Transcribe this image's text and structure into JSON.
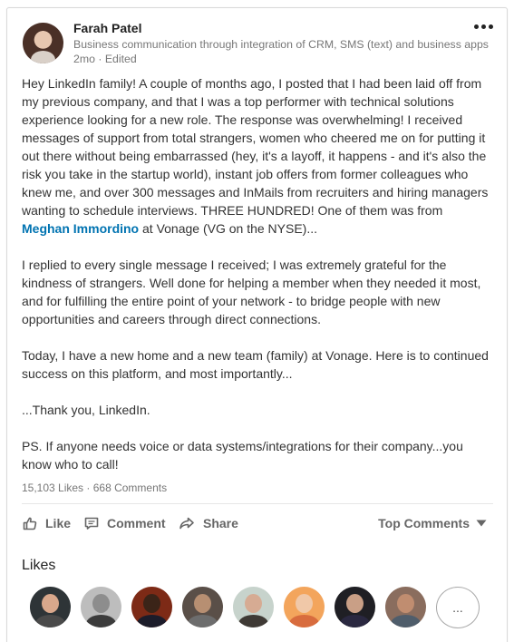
{
  "post": {
    "author_name": "Farah Patel",
    "author_headline": "Business communication through integration of CRM, SMS (text) and business apps",
    "meta": "2mo · Edited",
    "body": {
      "p1_before": "Hey LinkedIn family!  A couple of months ago, I posted that I had been laid off from my previous company, and that I was a top performer with technical solutions experience looking for a new role.  The response was overwhelming!  I received messages of support from total strangers, women who cheered me on for putting it out there without being embarrassed (hey, it's a layoff, it happens - and it's also the risk you take in the startup world), instant job offers from former colleagues who knew me, and over 300 messages and InMails from recruiters and hiring managers wanting to schedule interviews.  THREE HUNDRED! One of them was from ",
      "mention": "Meghan Immordino",
      "p1_after": " at Vonage (VG on the NYSE)...",
      "p2": "I replied to every single message I received; I was extremely grateful for the kindness of strangers.  Well done for helping a member when they needed it most, and for fulfilling the entire point of your network - to bridge people with new opportunities and careers through direct connections.",
      "p3": "Today, I have a new home and a new team (family) at Vonage. Here is to continued success on this platform, and most importantly...",
      "p4": "...Thank you, LinkedIn.",
      "p5": "PS.  If anyone needs voice or data systems/integrations for their company...you know who to call!"
    },
    "stats": "15,103 Likes · 668 Comments"
  },
  "actions": {
    "like": "Like",
    "comment": "Comment",
    "share": "Share",
    "sort": "Top Comments"
  },
  "likes_section": {
    "title": "Likes",
    "more": "..."
  },
  "colors": {
    "link": "#0073b1",
    "action_text": "#666666",
    "muted_text": "#777777"
  },
  "icons": [
    "more-horizontal-icon",
    "like-thumb-icon",
    "comment-icon",
    "share-arrow-icon",
    "caret-down-icon"
  ]
}
